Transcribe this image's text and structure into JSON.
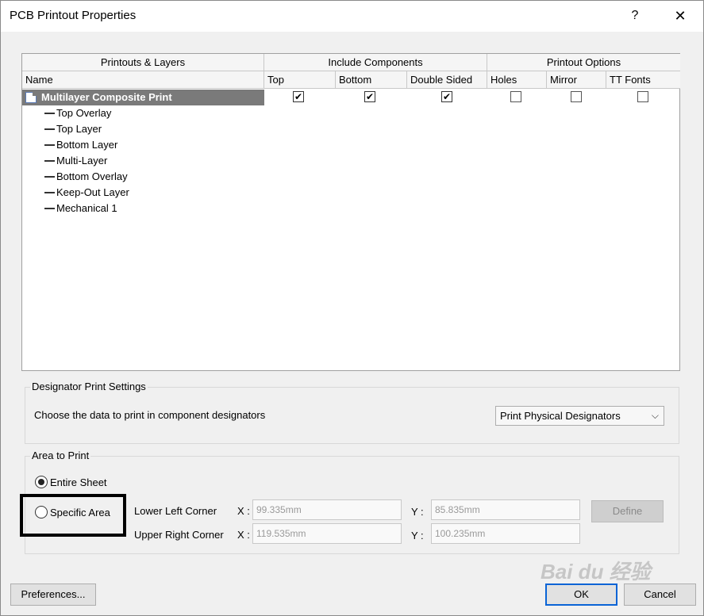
{
  "window": {
    "title": "PCB Printout Properties",
    "help_glyph": "?",
    "close_glyph": "✕"
  },
  "grid": {
    "groups": [
      "Printouts & Layers",
      "Include Components",
      "Printout Options"
    ],
    "columns": [
      "Name",
      "Top",
      "Bottom",
      "Double Sided",
      "Holes",
      "Mirror",
      "TT Fonts"
    ],
    "root": {
      "label": "Multilayer Composite Print",
      "checks": {
        "top": true,
        "bottom": true,
        "double_sided": true,
        "holes": false,
        "mirror": false,
        "tt_fonts": false
      }
    },
    "layers": [
      "Top Overlay",
      "Top Layer",
      "Bottom Layer",
      "Multi-Layer",
      "Bottom Overlay",
      "Keep-Out Layer",
      "Mechanical 1"
    ],
    "check_glyph": "✔"
  },
  "designator": {
    "legend": "Designator Print Settings",
    "prompt": "Choose the data to print in component designators",
    "selected": "Print Physical Designators",
    "arrow": "⌵"
  },
  "area": {
    "legend": "Area to Print",
    "entire_sheet": "Entire Sheet",
    "specific_area": "Specific Area",
    "lower_left": "Lower Left Corner",
    "upper_right": "Upper Right Corner",
    "x_label": "X :",
    "y_label": "Y :",
    "ll_x": "99.335mm",
    "ll_y": "85.835mm",
    "ur_x": "119.535mm",
    "ur_y": "100.235mm",
    "define": "Define",
    "selected_option": "entire_sheet"
  },
  "footer": {
    "preferences": "Preferences...",
    "ok": "OK",
    "cancel": "Cancel"
  },
  "watermark": "Bai du 经验"
}
